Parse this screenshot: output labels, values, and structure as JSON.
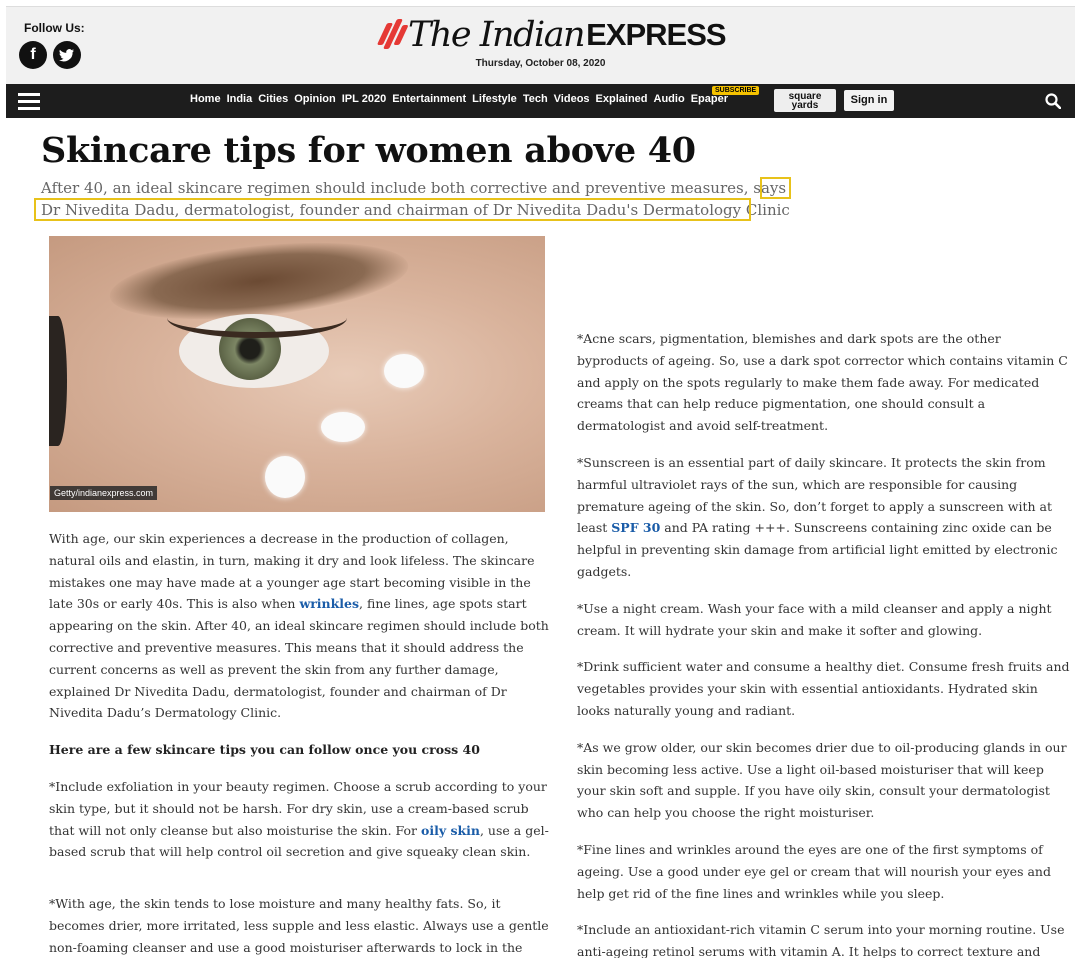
{
  "header": {
    "follow_label": "Follow Us:",
    "logo_the": "The Indian",
    "logo_express": "EXPRESS",
    "date": "Thursday, October 08, 2020"
  },
  "nav": {
    "items": [
      "Home",
      "India",
      "Cities",
      "Opinion",
      "IPL 2020",
      "Entertainment",
      "Lifestyle",
      "Tech",
      "Videos",
      "Explained",
      "Audio",
      "Epaper"
    ],
    "subscribe_badge": "SUBSCRIBE",
    "square_yards_1": "square",
    "square_yards_2": "yards",
    "signin": "Sign in"
  },
  "article": {
    "title": "Skincare tips for women above 40",
    "synopsis": "After 40, an ideal skincare regimen should include both corrective and preventive measures, says Dr Nivedita Dadu, dermatologist, founder and chairman of Dr Nivedita Dadu's Dermatology Clinic",
    "image_credit": "Getty/indianexpress.com",
    "intro_a": "With age, our skin experiences a decrease in the production of collagen, natural oils and elastin, in turn, making it dry and look lifeless. The skincare mistakes one may have made at a younger age start becoming visible in the late 30s or early 40s. This is also when ",
    "intro_link": "wrinkles",
    "intro_b": ", fine lines, age spots start appearing on the skin. After 40, an ideal skincare regimen should include both corrective and preventive measures. This means that it should address the current concerns as well as prevent the skin from any further damage, explained Dr Nivedita Dadu, dermatologist, founder and chairman of Dr Nivedita Dadu’s Dermatology Clinic.",
    "subhead": "Here are a few skincare tips you can follow once you cross 40",
    "tip1_a": "*Include exfoliation in your beauty regimen. Choose a scrub according to your skin type, but it should not be harsh. For dry skin, use a cream-based scrub that will not only cleanse but also moisturise the skin. For ",
    "tip1_link": "oily skin",
    "tip1_b": ", use a gel-based scrub that will help control oil secretion and give squeaky clean skin.",
    "tip2": "*With age, the skin tends to lose moisture and many healthy fats. So, it becomes drier, more irritated, less supple and less elastic. Always use a gentle non-foaming cleanser and use a good moisturiser afterwards to lock in the moisture.",
    "tip3": "*Acne scars, pigmentation, blemishes and dark spots are the other byproducts of ageing. So, use a dark spot corrector which contains vitamin C and apply on the spots regularly to make them fade away. For medicated creams that can help reduce pigmentation, one should consult a dermatologist and avoid self-treatment.",
    "tip4_a": "*Sunscreen is an essential part of daily skincare. It protects the skin from harmful ultraviolet rays of the sun, which are responsible for causing premature ageing of the skin. So, don’t forget to apply a sunscreen with at least ",
    "tip4_link": "SPF 30",
    "tip4_b": " and PA rating +++. Sunscreens containing zinc oxide can be helpful in preventing skin damage from artificial light emitted by electronic gadgets.",
    "tip5": "*Use a night cream. Wash your face with a mild cleanser and apply a night cream. It will hydrate your skin and make it softer and glowing.",
    "tip6": "*Drink sufficient water and consume a healthy diet. Consume fresh fruits and vegetables provides your skin with essential antioxidants. Hydrated skin looks naturally young and radiant.",
    "tip7": "*As we grow older, our skin becomes drier due to oil-producing glands in our skin becoming less active. Use a light oil-based moisturiser that will keep your skin soft and supple. If you have oily skin, consult your dermatologist who can help you choose the right moisturiser.",
    "tip8": "*Fine lines and wrinkles around the eyes are one of the first symptoms of ageing. Use a good under eye gel or cream that will nourish your eyes and help get rid of the fine lines and wrinkles while you sleep.",
    "tip9": "*Include an antioxidant-rich vitamin C serum into your morning routine. Use anti-ageing retinol serums with vitamin A. It helps to correct texture and reduce the appearance of visible signs of ageing."
  },
  "colors": {
    "nav_bg": "#1d1d1d",
    "link": "#1a5ca8",
    "highlight": "#e8c21a",
    "logo_red": "#e53935"
  }
}
